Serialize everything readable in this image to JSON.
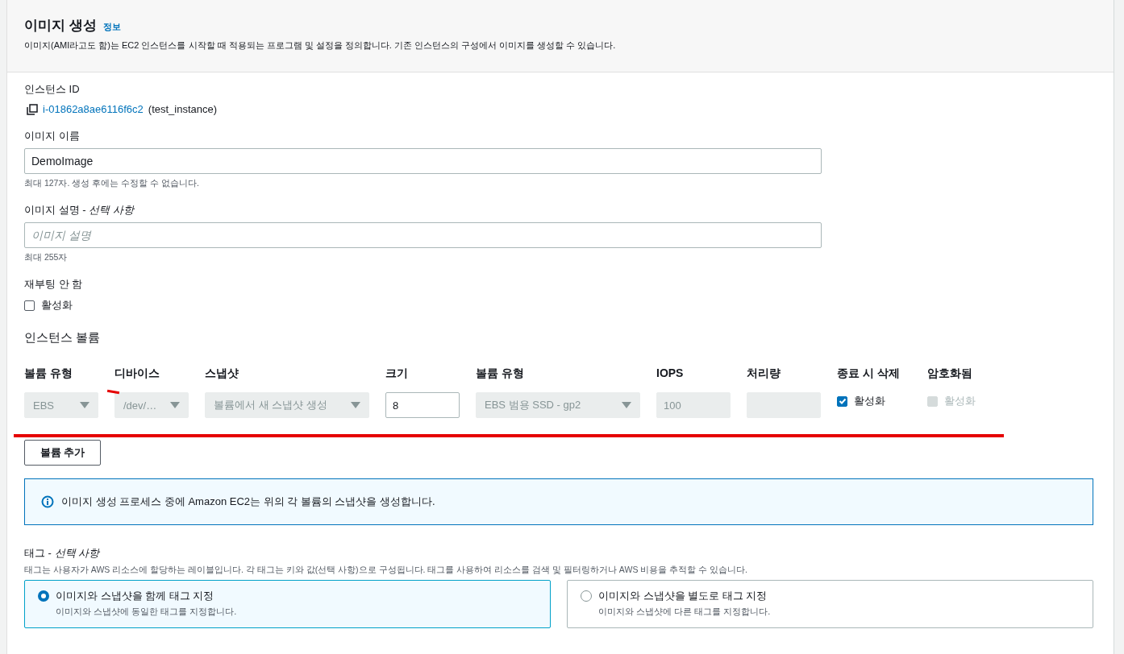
{
  "header": {
    "title": "이미지 생성",
    "info_link": "정보",
    "description": "이미지(AMI라고도 함)는 EC2 인스턴스를 시작할 때 적용되는 프로그램 및 설정을 정의합니다. 기존 인스턴스의 구성에서 이미지를 생성할 수 있습니다."
  },
  "instance": {
    "label": "인스턴스 ID",
    "id": "i-01862a8ae6116f6c2",
    "name": "(test_instance)"
  },
  "image_name": {
    "label": "이미지 이름",
    "value": "DemoImage",
    "hint": "최대 127자. 생성 후에는 수정할 수 없습니다."
  },
  "image_description": {
    "label": "이미지 설명 - *선택 사항*",
    "placeholder": "이미지 설명",
    "hint": "최대 255자"
  },
  "no_reboot": {
    "label": "재부팅 안 함",
    "option": "활성화",
    "checked": false
  },
  "volumes": {
    "title": "인스턴스 볼륨",
    "columns": [
      {
        "label": "볼륨 유형"
      },
      {
        "label": "디바이스"
      },
      {
        "label": "스냅샷"
      },
      {
        "label": "크기"
      },
      {
        "label": "볼륨 유형"
      },
      {
        "label": "IOPS"
      },
      {
        "label": "처리량"
      },
      {
        "label": "종료 시 삭제"
      },
      {
        "label": "암호화됨"
      }
    ],
    "cells": [
      {
        "kind": "select",
        "value": "EBS",
        "disabled": true
      },
      {
        "kind": "select",
        "value": "/dev/…",
        "disabled": true
      },
      {
        "kind": "select",
        "value": "볼륨에서 새 스냅샷 생성",
        "disabled": true
      },
      {
        "kind": "input",
        "value": "8",
        "disabled": false
      },
      {
        "kind": "select",
        "value": "EBS 범용 SSD - gp2",
        "disabled": true
      },
      {
        "kind": "input",
        "value": "100",
        "disabled": true
      },
      {
        "kind": "input",
        "disabled": true
      },
      {
        "kind": "checkbox",
        "label": "활성화",
        "checked": true,
        "disabled": false
      },
      {
        "kind": "checkbox",
        "label": "활성화",
        "checked": false,
        "disabled": true
      }
    ],
    "add_button": "볼륨 추가"
  },
  "info_alert": "이미지 생성 프로세스 중에 Amazon EC2는 위의 각 볼륨의 스냅샷을 생성합니다.",
  "tags": {
    "label": "태그 - *선택 사항*",
    "description": "태그는 사용자가 AWS 리소스에 할당하는 레이블입니다. 각 태그는 키와 값(선택 사항)으로 구성됩니다. 태그를 사용하여 리소스를 검색 및 필터링하거나 AWS 비용을 추적할 수 있습니다.",
    "options": [
      {
        "title": "이미지와 스냅샷을 함께 태그 지정",
        "description": "이미지와 스냅샷에 동일한 태그를 지정합니다.",
        "selected": true
      },
      {
        "title": "이미지와 스냅샷을 별도로 태그 지정",
        "description": "이미지와 스냅샷에 다른 태그를 지정합니다.",
        "selected": false
      }
    ]
  }
}
